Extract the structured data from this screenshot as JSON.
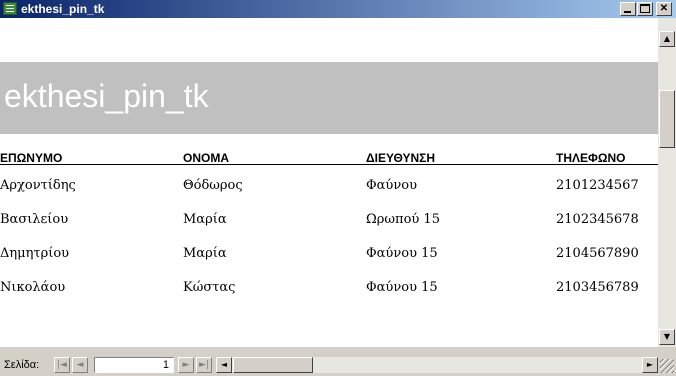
{
  "window": {
    "title": "ekthesi_pin_tk"
  },
  "report": {
    "title": "ekthesi_pin_tk",
    "columns": [
      "ΕΠΩΝΥΜΟ",
      "ΟΝΟΜΑ",
      "ΔΙΕΥΘΥΝΣΗ",
      "ΤΗΛΕΦΩΝΟ"
    ],
    "rows": [
      [
        "Αρχοντίδης",
        "Θόδωρος",
        "Φαύνου",
        "2101234567"
      ],
      [
        "Βασιλείου",
        "Μαρία",
        "Ωρωπού 15",
        "2102345678"
      ],
      [
        "Δημητρίου",
        "Μαρία",
        "Φαύνου 15",
        "2104567890"
      ],
      [
        "Νικολάου",
        "Κώστας",
        "Φαύνου 15",
        "2103456789"
      ]
    ]
  },
  "navigation": {
    "page_label": "Σελίδα:",
    "page_number": "1"
  },
  "icons": {
    "first": "first-record-icon",
    "prev": "previous-record-icon",
    "next": "next-record-icon",
    "last": "last-record-icon"
  }
}
